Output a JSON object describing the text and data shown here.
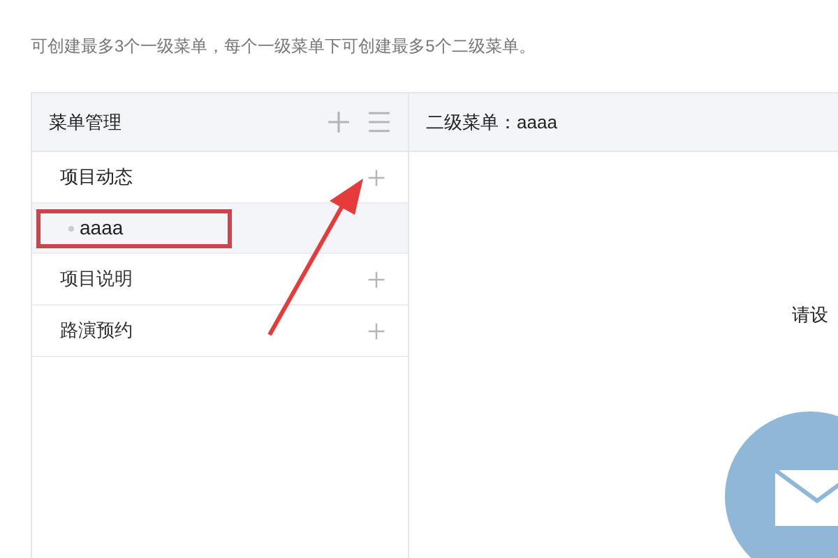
{
  "notice": "可创建最多3个一级菜单，每个一级菜单下可创建最多5个二级菜单。",
  "menu_panel": {
    "title": "菜单管理",
    "items": [
      {
        "label": "项目动态",
        "expanded": true,
        "children": [
          {
            "label": "aaaa",
            "selected": true,
            "highlighted": true
          }
        ]
      },
      {
        "label": "项目说明",
        "expanded": false
      },
      {
        "label": "路演预约",
        "expanded": false
      }
    ]
  },
  "detail_panel": {
    "title": "二级菜单：aaaa",
    "prompt": "请设"
  },
  "annotation_arrow": true
}
